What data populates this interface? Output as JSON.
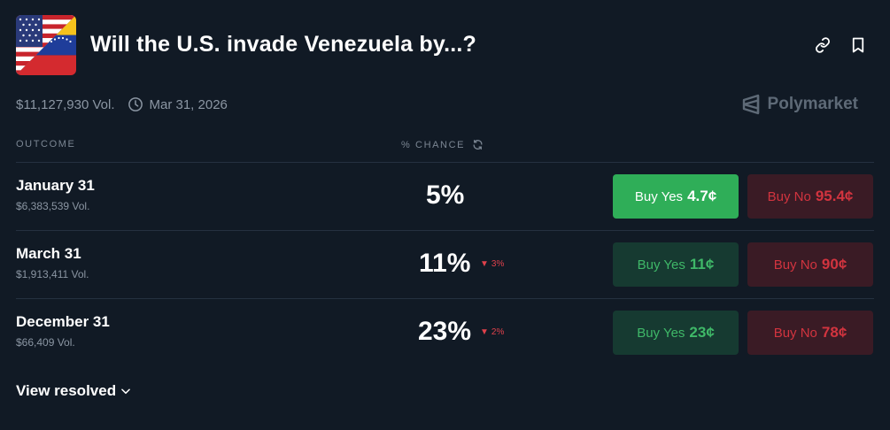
{
  "header": {
    "title": "Will the U.S. invade Venezuela by...?",
    "flag_icon": "us-venezuela-flag-icon",
    "link_icon": "link-icon",
    "bookmark_icon": "bookmark-icon"
  },
  "meta": {
    "volume": "$11,127,930 Vol.",
    "date": "Mar 31, 2026",
    "brand": "Polymarket"
  },
  "columns": {
    "outcome": "OUTCOME",
    "chance": "% CHANCE"
  },
  "outcomes": [
    {
      "label": "January 31",
      "volume": "$6,383,539 Vol.",
      "chance": "5%",
      "delta": "",
      "buy_yes_label": "Buy Yes",
      "buy_yes_price": "4.7¢",
      "buy_no_label": "Buy No",
      "buy_no_price": "95.4¢"
    },
    {
      "label": "March 31",
      "volume": "$1,913,411 Vol.",
      "chance": "11%",
      "delta": "3%",
      "buy_yes_label": "Buy Yes",
      "buy_yes_price": "11¢",
      "buy_no_label": "Buy No",
      "buy_no_price": "90¢"
    },
    {
      "label": "December 31",
      "volume": "$66,409 Vol.",
      "chance": "23%",
      "delta": "2%",
      "buy_yes_label": "Buy Yes",
      "buy_yes_price": "23¢",
      "buy_no_label": "Buy No",
      "buy_no_price": "78¢"
    }
  ],
  "footer": {
    "view_resolved": "View resolved"
  },
  "colors": {
    "background": "#111a25",
    "yes_active": "#2fae58",
    "yes": "#3fb868",
    "no": "#d2343f",
    "down": "#e0414b"
  }
}
